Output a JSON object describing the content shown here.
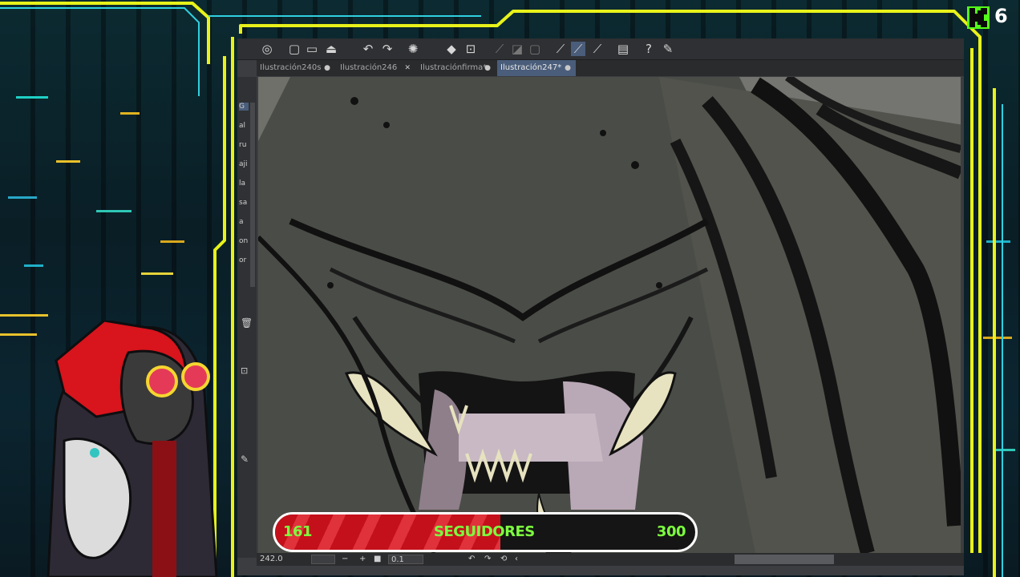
{
  "overlay": {
    "frame_color": "#e8f21a",
    "accent_color": "#2fd0e0",
    "badge_color": "#53fc18",
    "badge_count": "6"
  },
  "app": {
    "toolbar_icons": [
      "layers-icon",
      "new-file-icon",
      "open-folder-icon",
      "save-icon",
      "undo-icon",
      "redo-icon",
      "loading-icon",
      "fill-icon",
      "transform-icon",
      "ruler-icon",
      "pen-tool-icon",
      "brush-icon",
      "eraser-icon",
      "document-icon",
      "help-icon",
      "pencil-icon"
    ],
    "tabs": [
      {
        "label": "Ilustración240s",
        "modified": "●"
      },
      {
        "label": "Ilustración246",
        "modified": "✕"
      },
      {
        "label": "Ilustraciónfirma*",
        "modified": "●"
      },
      {
        "label": "Ilustración247*",
        "modified": "●"
      }
    ],
    "left_panel_items": [
      "G",
      "al",
      "ru",
      "aji",
      "la",
      "sa",
      "a",
      "on",
      "or"
    ],
    "status": {
      "zoom": "242.0",
      "brush_size": "0.1"
    }
  },
  "followers": {
    "current": "161",
    "label": "SEGUIDORES",
    "goal": "300",
    "progress": 0.537,
    "fill_color": "#c4101b",
    "text_color": "#7dff3f"
  }
}
